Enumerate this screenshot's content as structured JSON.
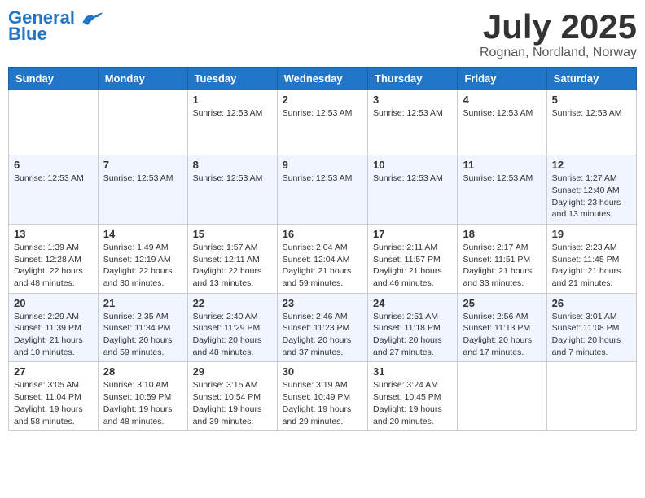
{
  "logo": {
    "line1": "General",
    "line2": "Blue"
  },
  "title": "July 2025",
  "location": "Rognan, Nordland, Norway",
  "weekdays": [
    "Sunday",
    "Monday",
    "Tuesday",
    "Wednesday",
    "Thursday",
    "Friday",
    "Saturday"
  ],
  "weeks": [
    [
      {
        "day": "",
        "info": ""
      },
      {
        "day": "",
        "info": ""
      },
      {
        "day": "1",
        "info": "Sunrise: 12:53 AM"
      },
      {
        "day": "2",
        "info": "Sunrise: 12:53 AM"
      },
      {
        "day": "3",
        "info": "Sunrise: 12:53 AM"
      },
      {
        "day": "4",
        "info": "Sunrise: 12:53 AM"
      },
      {
        "day": "5",
        "info": "Sunrise: 12:53 AM"
      }
    ],
    [
      {
        "day": "6",
        "info": "Sunrise: 12:53 AM"
      },
      {
        "day": "7",
        "info": "Sunrise: 12:53 AM"
      },
      {
        "day": "8",
        "info": "Sunrise: 12:53 AM"
      },
      {
        "day": "9",
        "info": "Sunrise: 12:53 AM"
      },
      {
        "day": "10",
        "info": "Sunrise: 12:53 AM"
      },
      {
        "day": "11",
        "info": "Sunrise: 12:53 AM"
      },
      {
        "day": "12",
        "info": "Sunrise: 1:27 AM\nSunset: 12:40 AM\nDaylight: 23 hours and 13 minutes."
      }
    ],
    [
      {
        "day": "13",
        "info": "Sunrise: 1:39 AM\nSunset: 12:28 AM\nDaylight: 22 hours and 48 minutes."
      },
      {
        "day": "14",
        "info": "Sunrise: 1:49 AM\nSunset: 12:19 AM\nDaylight: 22 hours and 30 minutes."
      },
      {
        "day": "15",
        "info": "Sunrise: 1:57 AM\nSunset: 12:11 AM\nDaylight: 22 hours and 13 minutes."
      },
      {
        "day": "16",
        "info": "Sunrise: 2:04 AM\nSunset: 12:04 AM\nDaylight: 21 hours and 59 minutes."
      },
      {
        "day": "17",
        "info": "Sunrise: 2:11 AM\nSunset: 11:57 PM\nDaylight: 21 hours and 46 minutes."
      },
      {
        "day": "18",
        "info": "Sunrise: 2:17 AM\nSunset: 11:51 PM\nDaylight: 21 hours and 33 minutes."
      },
      {
        "day": "19",
        "info": "Sunrise: 2:23 AM\nSunset: 11:45 PM\nDaylight: 21 hours and 21 minutes."
      }
    ],
    [
      {
        "day": "20",
        "info": "Sunrise: 2:29 AM\nSunset: 11:39 PM\nDaylight: 21 hours and 10 minutes."
      },
      {
        "day": "21",
        "info": "Sunrise: 2:35 AM\nSunset: 11:34 PM\nDaylight: 20 hours and 59 minutes."
      },
      {
        "day": "22",
        "info": "Sunrise: 2:40 AM\nSunset: 11:29 PM\nDaylight: 20 hours and 48 minutes."
      },
      {
        "day": "23",
        "info": "Sunrise: 2:46 AM\nSunset: 11:23 PM\nDaylight: 20 hours and 37 minutes."
      },
      {
        "day": "24",
        "info": "Sunrise: 2:51 AM\nSunset: 11:18 PM\nDaylight: 20 hours and 27 minutes."
      },
      {
        "day": "25",
        "info": "Sunrise: 2:56 AM\nSunset: 11:13 PM\nDaylight: 20 hours and 17 minutes."
      },
      {
        "day": "26",
        "info": "Sunrise: 3:01 AM\nSunset: 11:08 PM\nDaylight: 20 hours and 7 minutes."
      }
    ],
    [
      {
        "day": "27",
        "info": "Sunrise: 3:05 AM\nSunset: 11:04 PM\nDaylight: 19 hours and 58 minutes."
      },
      {
        "day": "28",
        "info": "Sunrise: 3:10 AM\nSunset: 10:59 PM\nDaylight: 19 hours and 48 minutes."
      },
      {
        "day": "29",
        "info": "Sunrise: 3:15 AM\nSunset: 10:54 PM\nDaylight: 19 hours and 39 minutes."
      },
      {
        "day": "30",
        "info": "Sunrise: 3:19 AM\nSunset: 10:49 PM\nDaylight: 19 hours and 29 minutes."
      },
      {
        "day": "31",
        "info": "Sunrise: 3:24 AM\nSunset: 10:45 PM\nDaylight: 19 hours and 20 minutes."
      },
      {
        "day": "",
        "info": ""
      },
      {
        "day": "",
        "info": ""
      }
    ]
  ]
}
